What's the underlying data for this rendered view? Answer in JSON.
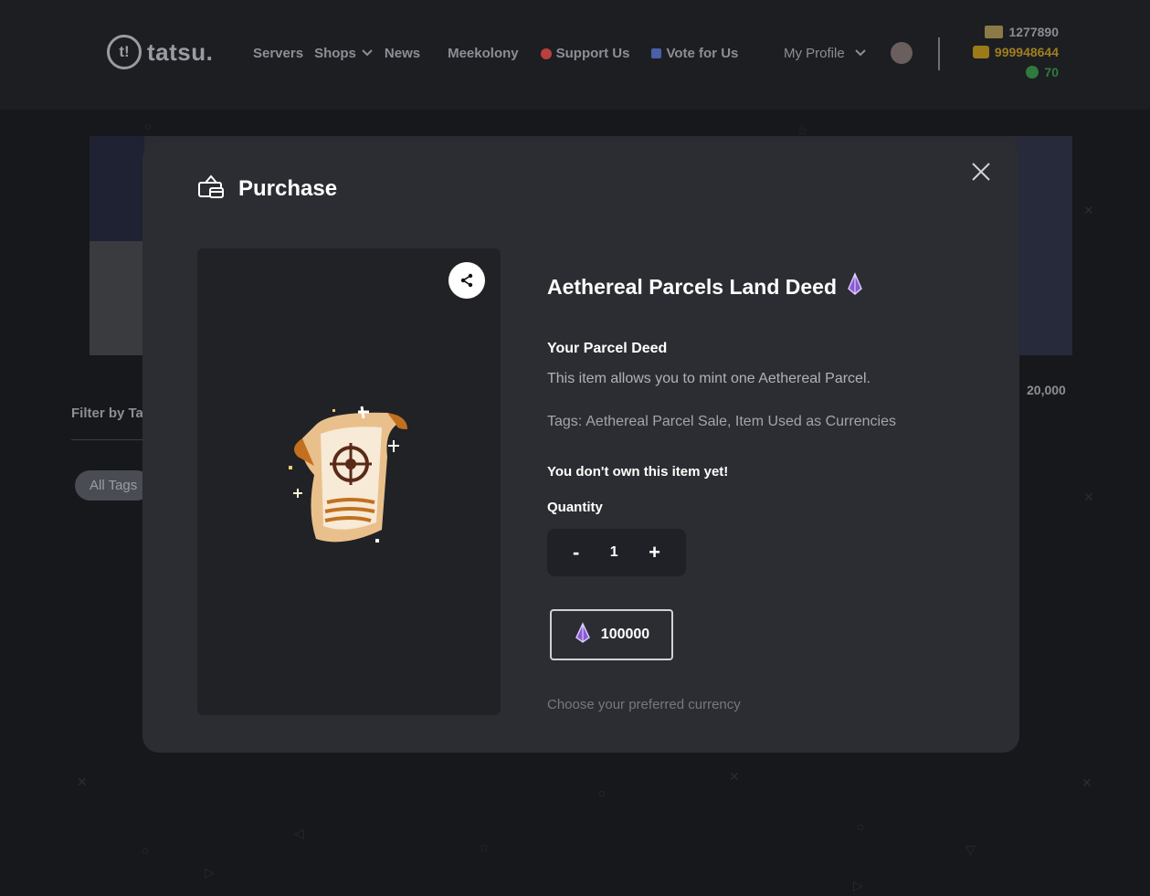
{
  "nav": {
    "logo_mark": "t!",
    "logo_text": "tatsu.",
    "links": [
      "Servers",
      "Shops",
      "News",
      "Meekolony",
      "Support Us",
      "Vote for Us"
    ],
    "profile": "My Profile"
  },
  "balances": {
    "credits": "1277890",
    "tokens": "999948644",
    "rep": "70"
  },
  "background": {
    "price": "20,000",
    "filter_label": "Filter by Ta",
    "tag_pill": "All Tags"
  },
  "modal": {
    "title": "Purchase",
    "item_name": "Aethereal Parcels Land Deed",
    "subheading": "Your Parcel Deed",
    "description": "This item allows you to mint one Aethereal Parcel.",
    "tags_label": "Tags:",
    "tags": "Aethereal Parcel Sale, Item Used as Currencies",
    "ownership": "You don't own this item yet!",
    "quantity_label": "Quantity",
    "quantity": "1",
    "minus": "-",
    "plus": "+",
    "price": "100000",
    "currency_hint": "Choose your preferred currency"
  },
  "colors": {
    "modal_bg": "#2c2d32",
    "panel_bg": "#212226",
    "accent_gem": "#8a5ad0",
    "gold": "#a07f1f",
    "green": "#2f7a3f"
  },
  "icons": [
    "logo-icon",
    "chevron-down-icon",
    "heart-icon",
    "vote-icon",
    "avatar",
    "credits-icon",
    "tokens-icon",
    "rep-icon",
    "shopping-basket-icon",
    "close-icon",
    "share-icon",
    "gem-icon"
  ]
}
